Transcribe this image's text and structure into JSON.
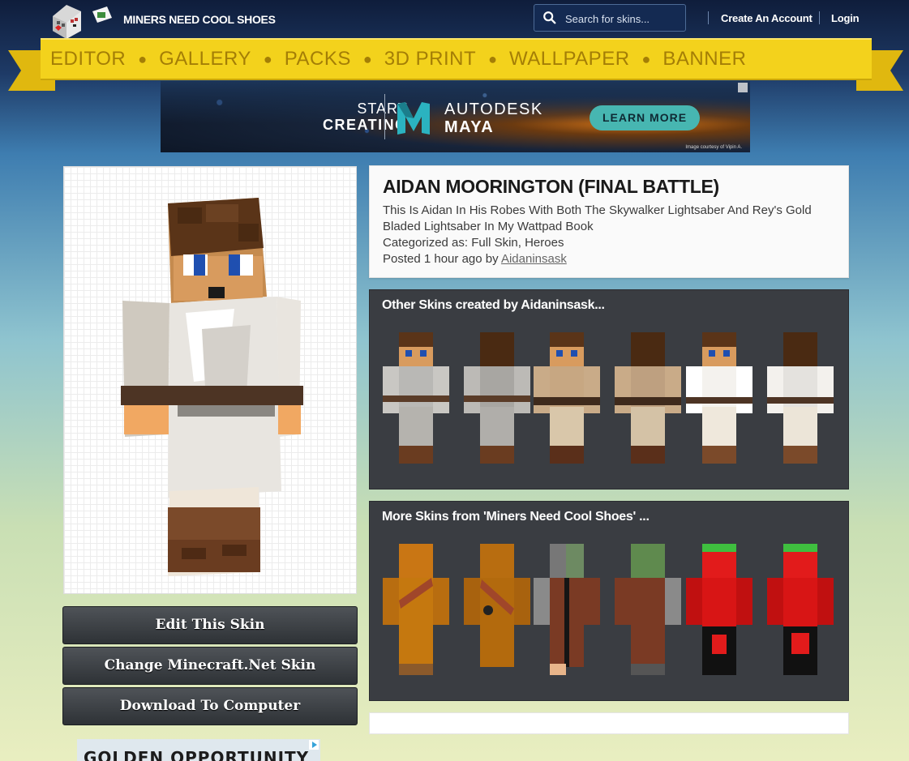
{
  "header": {
    "site_name": "MINERS NEED COOL SHOES",
    "search_placeholder": "Search for skins...",
    "create_account": "Create An Account",
    "login": "Login"
  },
  "nav": [
    "EDITOR",
    "GALLERY",
    "PACKS",
    "3D PRINT",
    "WALLPAPER",
    "BANNER"
  ],
  "ad_top": {
    "line1": "START",
    "line2": "CREATING",
    "brand1": "AUTODESK",
    "brand2": "MAYA",
    "cta": "LEARN MORE",
    "credit": "Image courtesy of Vipin A."
  },
  "skin": {
    "title": "AIDAN MOORINGTON (FINAL BATTLE)",
    "description": "This Is Aidan In His Robes With Both The Skywalker Lightsaber And Rey's Gold Bladed Lightsaber In My Wattpad Book",
    "categorized_label": "Categorized as:",
    "categories": "Full Skin, Heroes",
    "posted_prefix": "Posted 1 hour ago by",
    "author": "Aidaninsask"
  },
  "buttons": {
    "edit": "Edit This Skin",
    "change": "Change Minecraft.Net Skin",
    "download": "Download To Computer"
  },
  "other_skins": {
    "heading": "Other Skins created by Aidaninsask..."
  },
  "more_skins": {
    "heading": "More Skins from 'Miners Need Cool Shoes' ..."
  },
  "ad_bottom": {
    "text": "GOLDEN OPPORTUNITY"
  },
  "colors": {
    "ribbon": "#f3d21c",
    "ribbon_text": "#a47e06",
    "panel_dark": "#3a3d42",
    "button_dark": "#2e3236"
  }
}
